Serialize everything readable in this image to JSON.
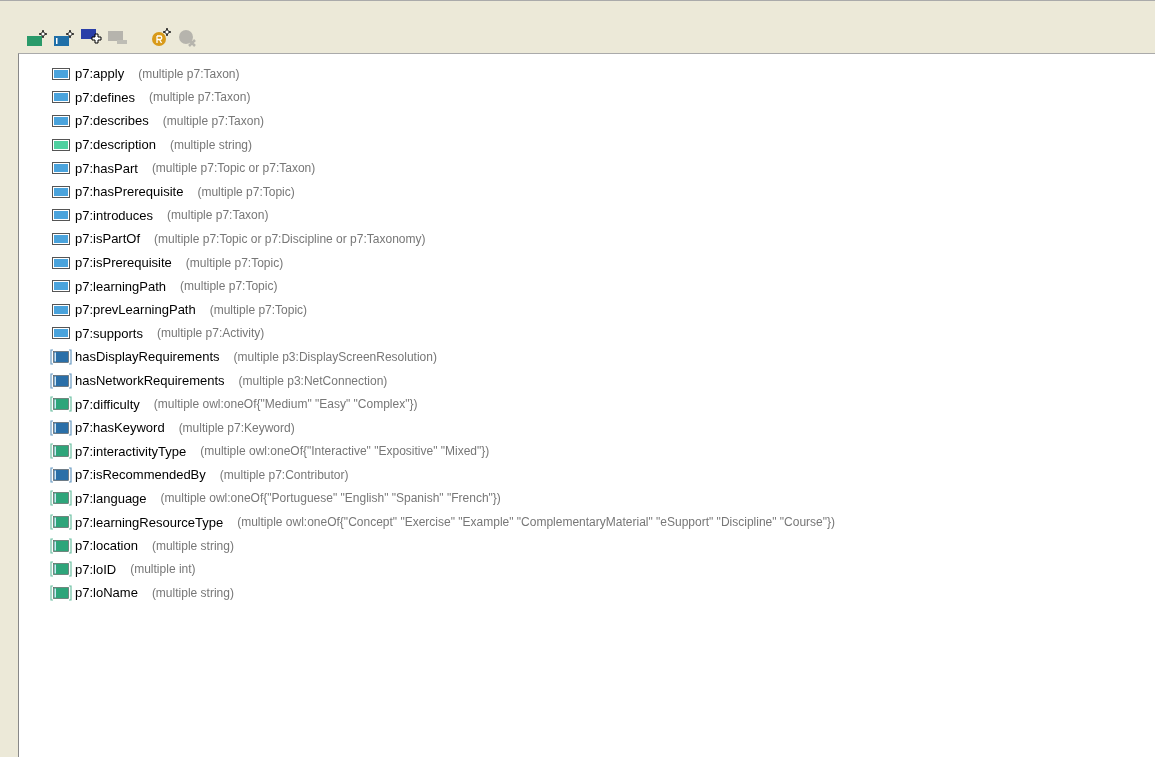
{
  "toolbar": [
    {
      "kind": "add-datatype",
      "disabled": false
    },
    {
      "kind": "add-object",
      "disabled": false
    },
    {
      "kind": "add-existing",
      "disabled": false
    },
    {
      "kind": "remove",
      "disabled": true
    },
    {
      "kind": "add-restriction",
      "disabled": false
    },
    {
      "kind": "delete-restriction",
      "disabled": true
    }
  ],
  "properties": [
    {
      "name": "p7:apply",
      "range": "(multiple p7:Taxon)",
      "kind": "object",
      "inherited": false
    },
    {
      "name": "p7:defines",
      "range": "(multiple p7:Taxon)",
      "kind": "object",
      "inherited": false
    },
    {
      "name": "p7:describes",
      "range": "(multiple p7:Taxon)",
      "kind": "object",
      "inherited": false
    },
    {
      "name": "p7:description",
      "range": "(multiple string)",
      "kind": "datatype",
      "inherited": false
    },
    {
      "name": "p7:hasPart",
      "range": "(multiple p7:Topic or p7:Taxon)",
      "kind": "object",
      "inherited": false
    },
    {
      "name": "p7:hasPrerequisite",
      "range": "(multiple p7:Topic)",
      "kind": "object",
      "inherited": false
    },
    {
      "name": "p7:introduces",
      "range": "(multiple p7:Taxon)",
      "kind": "object",
      "inherited": false
    },
    {
      "name": "p7:isPartOf",
      "range": "(multiple p7:Topic or p7:Discipline or p7:Taxonomy)",
      "kind": "object",
      "inherited": false
    },
    {
      "name": "p7:isPrerequisite",
      "range": "(multiple p7:Topic)",
      "kind": "object",
      "inherited": false
    },
    {
      "name": "p7:learningPath",
      "range": "(multiple p7:Topic)",
      "kind": "object",
      "inherited": false
    },
    {
      "name": "p7:prevLearningPath",
      "range": "(multiple p7:Topic)",
      "kind": "object",
      "inherited": false
    },
    {
      "name": "p7:supports",
      "range": "(multiple p7:Activity)",
      "kind": "object",
      "inherited": false
    },
    {
      "name": "hasDisplayRequirements",
      "range": "(multiple p3:DisplayScreenResolution)",
      "kind": "object",
      "inherited": true
    },
    {
      "name": "hasNetworkRequirements",
      "range": "(multiple p3:NetConnection)",
      "kind": "object",
      "inherited": true
    },
    {
      "name": "p7:difficulty",
      "range": "(multiple owl:oneOf{\"Medium\" \"Easy\" \"Complex\"})",
      "kind": "datatype",
      "inherited": true
    },
    {
      "name": "p7:hasKeyword",
      "range": "(multiple p7:Keyword)",
      "kind": "object",
      "inherited": true
    },
    {
      "name": "p7:interactivityType",
      "range": "(multiple owl:oneOf{\"Interactive\" \"Expositive\" \"Mixed\"})",
      "kind": "datatype",
      "inherited": true
    },
    {
      "name": "p7:isRecommendedBy",
      "range": "(multiple p7:Contributor)",
      "kind": "object",
      "inherited": true
    },
    {
      "name": "p7:language",
      "range": "(multiple owl:oneOf{\"Portuguese\" \"English\" \"Spanish\" \"French\"})",
      "kind": "datatype",
      "inherited": true
    },
    {
      "name": "p7:learningResourceType",
      "range": "(multiple owl:oneOf{\"Concept\" \"Exercise\" \"Example\" \"ComplementaryMaterial\" \"eSupport\" \"Discipline\" \"Course\"})",
      "kind": "datatype",
      "inherited": true
    },
    {
      "name": "p7:location",
      "range": "(multiple string)",
      "kind": "datatype",
      "inherited": true
    },
    {
      "name": "p7:loID",
      "range": "(multiple int)",
      "kind": "datatype",
      "inherited": true
    },
    {
      "name": "p7:loName",
      "range": "(multiple string)",
      "kind": "datatype",
      "inherited": true
    }
  ]
}
